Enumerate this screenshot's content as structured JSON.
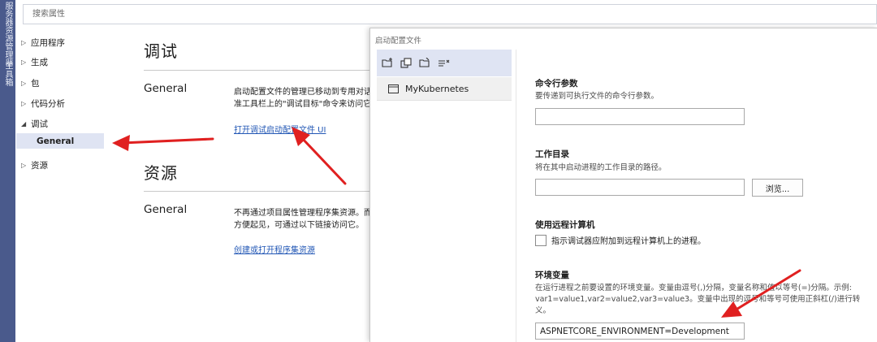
{
  "sidebar_strip": {
    "tab_1": "服务器资源管理器",
    "tab_2": "工具箱"
  },
  "search": {
    "placeholder": "搜索属性"
  },
  "nav": {
    "items": [
      {
        "label": "应用程序"
      },
      {
        "label": "生成"
      },
      {
        "label": "包"
      },
      {
        "label": "代码分析"
      },
      {
        "label": "调试"
      },
      {
        "label": "资源"
      }
    ],
    "selected_sub": "General"
  },
  "debug_section": {
    "title": "调试",
    "general_label": "General",
    "desc_line1": "启动配置文件的管理已移动到专用对话框。",
    "desc_line2": "准工具栏上的\"调试目标\"命令来访问它。",
    "link": "打开调试启动配置文件 UI"
  },
  "resources_section": {
    "title": "资源",
    "general_label": "General",
    "desc_line1": "不再通过项目属性管理程序集资源。而",
    "desc_line2": "方便起见，可通过以下链接访问它。",
    "link": "创建或打开程序集资源"
  },
  "dialog": {
    "title": "启动配置文件",
    "toolbar_icons": [
      "new-profile-icon",
      "copy-profile-icon",
      "rename-profile-icon",
      "delete-profile-icon"
    ],
    "profile": "MyKubernetes",
    "cmd_args": {
      "label": "命令行参数",
      "desc": "要传递到可执行文件的命令行参数。",
      "value": ""
    },
    "working_dir": {
      "label": "工作目录",
      "desc": "将在其中启动进程的工作目录的路径。",
      "value": "",
      "browse": "浏览..."
    },
    "remote": {
      "label": "使用远程计算机",
      "checkbox_label": "指示调试器应附加到远程计算机上的进程。",
      "checked": false
    },
    "env": {
      "label": "环境变量",
      "desc_line1": "在运行进程之前要设置的环境变量。变量由逗号(,)分隔，变量名称和值以等号(=)分隔。示例:",
      "desc_line2": "var1=value1,var2=value2,var3=value3。变量中出现的逗号和等号可使用正斜杠(/)进行转",
      "desc_line3": "义。",
      "value": "ASPNETCORE_ENVIRONMENT=Development"
    }
  },
  "colors": {
    "accent": "#4a5a8c",
    "selection": "#dfe4f3",
    "link": "#2257b5",
    "arrow": "#e02020"
  }
}
